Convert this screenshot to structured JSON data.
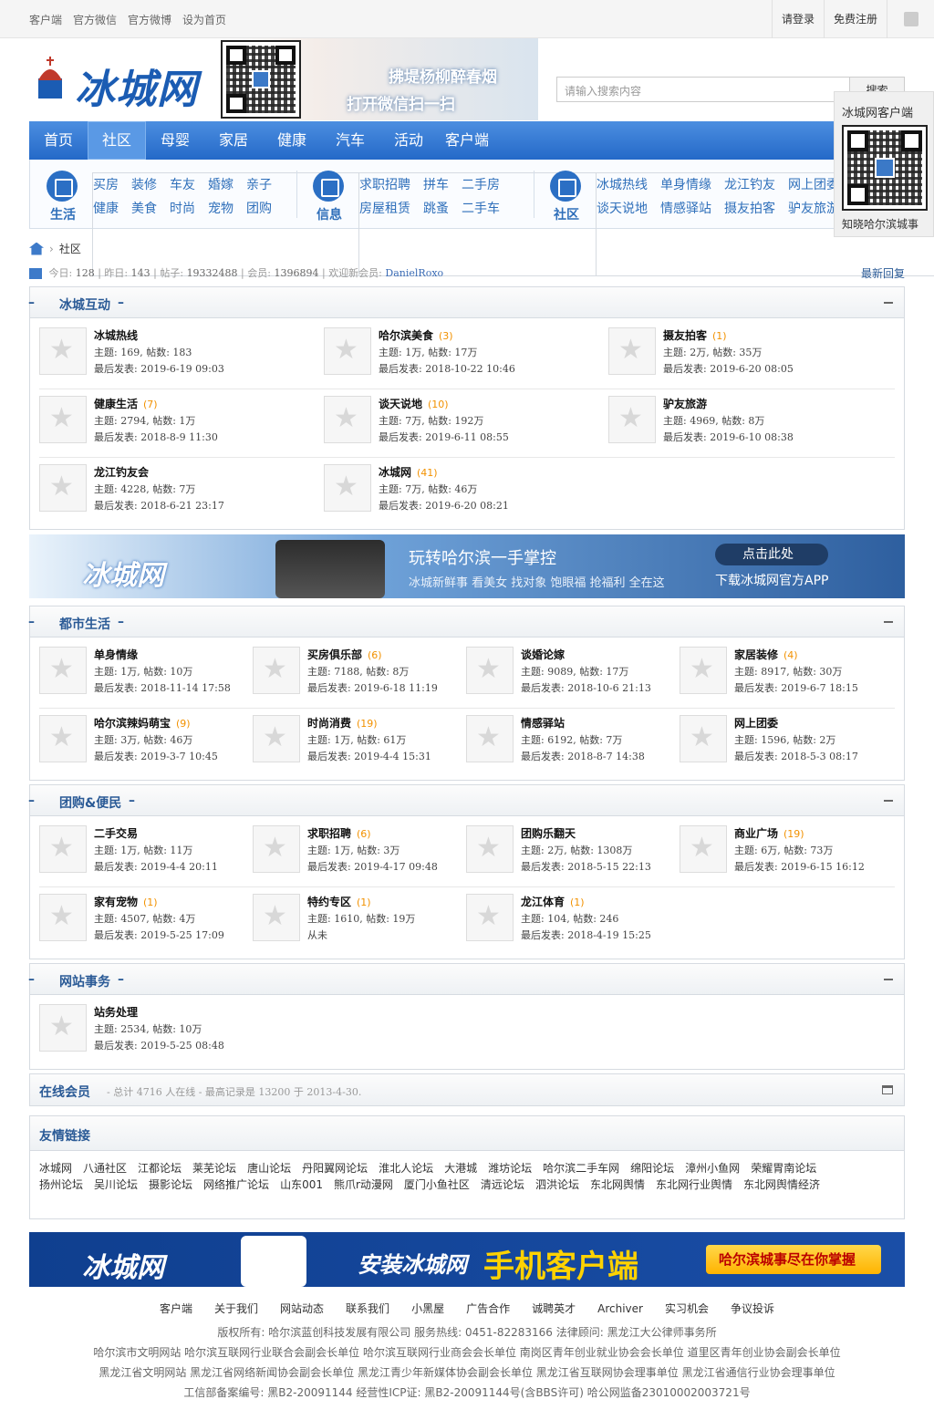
{
  "topbar": {
    "left": [
      "客户端",
      "官方微信",
      "官方微博",
      "设为首页"
    ],
    "login": "请登录",
    "register": "免费注册"
  },
  "header": {
    "logo": "冰城网",
    "qr_line1": "拂堤杨柳醉春烟",
    "qr_line2": "打开微信扫一扫",
    "search_placeholder": "请输入搜索内容",
    "search_btn": "搜索"
  },
  "nav": [
    "首页",
    "社区",
    "母婴",
    "家居",
    "健康",
    "汽车",
    "活动",
    "客户端"
  ],
  "subnav": [
    {
      "label": "生活",
      "row1": [
        "买房",
        "装修",
        "车友",
        "婚嫁",
        "亲子"
      ],
      "row2": [
        "健康",
        "美食",
        "时尚",
        "宠物",
        "团购"
      ]
    },
    {
      "label": "信息",
      "row1": [
        "求职招聘",
        "拼车",
        "二手房"
      ],
      "row2": [
        "房屋租赁",
        "跳蚤",
        "二手车"
      ]
    },
    {
      "label": "社区",
      "row1": [
        "冰城热线",
        "单身情缘",
        "龙江钓友",
        "网上团委"
      ],
      "row2": [
        "谈天说地",
        "情感驿站",
        "摄友拍客",
        "驴友旅游"
      ]
    }
  ],
  "float_box": {
    "title": "冰城网客户端",
    "bottom": "知晓哈尔滨城事"
  },
  "crumb": "社区",
  "stats": {
    "today_l": "今日:",
    "today": "128",
    "yest_l": "昨日:",
    "yest": "143",
    "posts_l": "帖子:",
    "posts": "19332488",
    "members_l": "会员:",
    "members": "1396894",
    "welcome": "欢迎新会员:",
    "newest": "DanielRoxo",
    "latest": "最新回复"
  },
  "boards": [
    {
      "title": "冰城互动",
      "items": [
        {
          "name": "冰城热线",
          "count": "",
          "s1": "主题: 169, 帖数: 183",
          "s2": "最后发表: 2019-6-19 09:03"
        },
        {
          "name": "哈尔滨美食",
          "count": "(3)",
          "s1": "主题: 1万, 帖数: 17万",
          "s2": "最后发表: 2018-10-22 10:46"
        },
        {
          "name": "摄友拍客",
          "count": "(1)",
          "s1": "主题: 2万, 帖数: 35万",
          "s2": "最后发表: 2019-6-20 08:05"
        },
        {
          "name": "健康生活",
          "count": "(7)",
          "s1": "主题: 2794, 帖数: 1万",
          "s2": "最后发表: 2018-8-9 11:30"
        },
        {
          "name": "谈天说地",
          "count": "(10)",
          "s1": "主题: 7万, 帖数: 192万",
          "s2": "最后发表: 2019-6-11 08:55"
        },
        {
          "name": "驴友旅游",
          "count": "",
          "s1": "主题: 4969, 帖数: 8万",
          "s2": "最后发表: 2019-6-10 08:38"
        },
        {
          "name": "龙江钓友会",
          "count": "",
          "s1": "主题: 4228, 帖数: 7万",
          "s2": "最后发表: 2018-6-21 23:17"
        },
        {
          "name": "冰城网",
          "count": "(41)",
          "s1": "主题: 7万, 帖数: 46万",
          "s2": "最后发表: 2019-6-20 08:21"
        }
      ]
    },
    {
      "title": "都市生活",
      "items": [
        {
          "name": "单身情缘",
          "count": "",
          "s1": "主题: 1万, 帖数: 10万",
          "s2": "最后发表: 2018-11-14 17:58"
        },
        {
          "name": "买房俱乐部",
          "count": "(6)",
          "s1": "主题: 7188, 帖数: 8万",
          "s2": "最后发表: 2019-6-18 11:19"
        },
        {
          "name": "谈婚论嫁",
          "count": "",
          "s1": "主题: 9089, 帖数: 17万",
          "s2": "最后发表: 2018-10-6 21:13"
        },
        {
          "name": "家居装修",
          "count": "(4)",
          "s1": "主题: 8917, 帖数: 30万",
          "s2": "最后发表: 2019-6-7 18:15"
        },
        {
          "name": "哈尔滨辣妈萌宝",
          "count": "(9)",
          "s1": "主题: 3万, 帖数: 46万",
          "s2": "最后发表: 2019-3-7 10:45"
        },
        {
          "name": "时尚消费",
          "count": "(19)",
          "s1": "主题: 1万, 帖数: 61万",
          "s2": "最后发表: 2019-4-4 15:31"
        },
        {
          "name": "情感驿站",
          "count": "",
          "s1": "主题: 6192, 帖数: 7万",
          "s2": "最后发表: 2018-8-7 14:38"
        },
        {
          "name": "网上团委",
          "count": "",
          "s1": "主题: 1596, 帖数: 2万",
          "s2": "最后发表: 2018-5-3 08:17"
        }
      ]
    },
    {
      "title": "团购&便民",
      "items": [
        {
          "name": "二手交易",
          "count": "",
          "s1": "主题: 1万, 帖数: 11万",
          "s2": "最后发表: 2019-4-4 20:11"
        },
        {
          "name": "求职招聘",
          "count": "(6)",
          "s1": "主题: 1万, 帖数: 3万",
          "s2": "最后发表: 2019-4-17 09:48"
        },
        {
          "name": "团购乐翻天",
          "count": "",
          "s1": "主题: 2万, 帖数: 1308万",
          "s2": "最后发表: 2018-5-15 22:13"
        },
        {
          "name": "商业广场",
          "count": "(19)",
          "s1": "主题: 6万, 帖数: 73万",
          "s2": "最后发表: 2019-6-15 16:12"
        },
        {
          "name": "家有宠物",
          "count": "(1)",
          "s1": "主题: 4507, 帖数: 4万",
          "s2": "最后发表: 2019-5-25 17:09"
        },
        {
          "name": "特约专区",
          "count": "(1)",
          "s1": "主题: 1610, 帖数: 19万",
          "s2": "从未"
        },
        {
          "name": "龙江体育",
          "count": "(1)",
          "s1": "主题: 104, 帖数: 246",
          "s2": "最后发表: 2018-4-19 15:25"
        }
      ]
    },
    {
      "title": "网站事务",
      "items": [
        {
          "name": "站务处理",
          "count": "",
          "s1": "主题: 2534, 帖数: 10万",
          "s2": "最后发表: 2019-5-25 08:48"
        }
      ]
    }
  ],
  "banner1": {
    "logo": "冰城网",
    "a": "玩转哈尔滨一手掌控",
    "b": "冰城新鲜事 看美女 找对象 饱眼福 抢福利 全在这",
    "c": "点击此处",
    "d": "下载冰城网官方APP"
  },
  "online": {
    "title": "在线会员",
    "text": "- 总计 4716 人在线 - 最高记录是 13200 于 2013-4-30."
  },
  "friend_links": {
    "title": "友情链接",
    "items": [
      "冰城网",
      "八通社区",
      "江都论坛",
      "莱芜论坛",
      "唐山论坛",
      "丹阳翼网论坛",
      "淮北人论坛",
      "大港城",
      "潍坊论坛",
      "哈尔滨二手车网",
      "绵阳论坛",
      "漳州小鱼网",
      "荣耀胃南论坛",
      "扬州论坛",
      "吴川论坛",
      "摄影论坛",
      "网络推广论坛",
      "山东001",
      "熊爪r动漫网",
      "厦门小鱼社区",
      "清远论坛",
      "泗洪论坛",
      "东北网舆情",
      "东北网行业舆情",
      "东北网舆情经济"
    ]
  },
  "banner2": {
    "logo": "冰城网",
    "a": "安装冰城网",
    "b": "手机客户端",
    "c": "哈尔滨城事尽在你掌握"
  },
  "footer": {
    "nav": [
      "客户端",
      "关于我们",
      "网站动态",
      "联系我们",
      "小黑屋",
      "广告合作",
      "诚聘英才",
      "Archiver",
      "实习机会",
      "争议投诉"
    ],
    "l1": "版权所有: 哈尔滨蓝创科技发展有限公司 服务热线: 0451-82283166 法律顾问: 黑龙江大公律师事务所",
    "l2": "哈尔滨市文明网站 哈尔滨互联网行业联合会副会长单位 哈尔滨互联网行业商会会长单位 南岗区青年创业就业协会会长单位 道里区青年创业协会副会长单位",
    "l3": "黑龙江省文明网站 黑龙江省网络新闻协会副会长单位 黑龙江青少年新媒体协会副会长单位 黑龙江省互联网协会理事单位 黑龙江省通信行业协会理事单位",
    "l4": "工信部备案编号: 黑B2-20091144 经营性ICP证: 黑B2-20091144号(含BBS许可) 哈公网监备23010002003721号"
  }
}
